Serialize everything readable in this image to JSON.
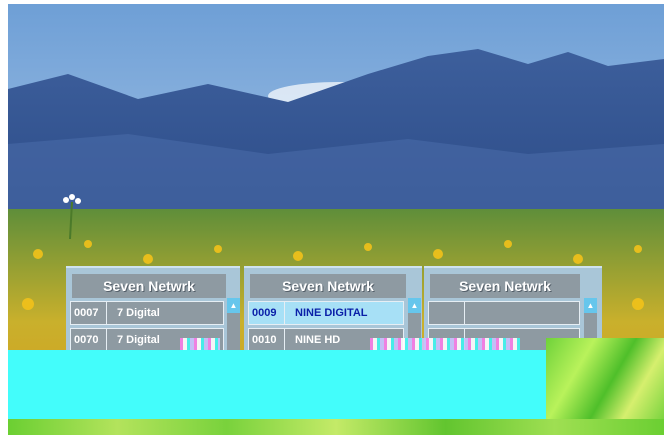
{
  "panels": [
    {
      "title": "Seven Netwrk",
      "rows": [
        {
          "num": "0007",
          "name": "7 Digital",
          "selected": false
        },
        {
          "num": "0070",
          "name": "7 Digital",
          "selected": false
        }
      ]
    },
    {
      "title": "Seven Netwrk",
      "rows": [
        {
          "num": "0009",
          "name": "NINE DIGITAL",
          "selected": true
        },
        {
          "num": "0010",
          "name": "NINE HD",
          "selected": false
        }
      ]
    },
    {
      "title": "Seven Netwrk",
      "rows": [
        {
          "num": "",
          "name": "",
          "selected": false
        },
        {
          "num": "",
          "name": "",
          "selected": false
        }
      ]
    }
  ],
  "colors": {
    "panel_bg": "#a9c6d8",
    "title_bar": "#8e9aa2",
    "selected_row": "#a7e0f6",
    "selected_text": "#0a1fa8",
    "cyan_overlay": "#43fdfb"
  },
  "icons": {
    "scroll_up": "scroll-up-arrow-icon"
  }
}
